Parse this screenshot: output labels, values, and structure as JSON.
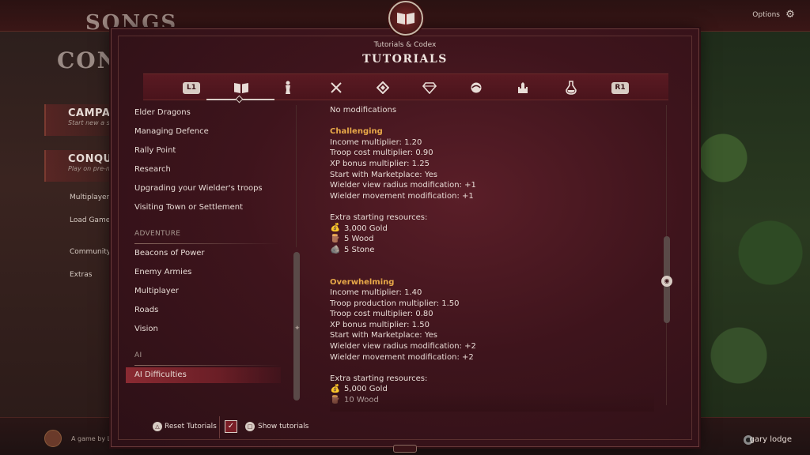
{
  "background": {
    "logo_line1": "SONGS",
    "logo_line2": "CONQ",
    "menu": {
      "campaign": {
        "label": "CAMPAIG",
        "sub": "Start new a st"
      },
      "conquest": {
        "label": "CONQUE",
        "sub": "Play on pre-m"
      },
      "multiplayer": "Multiplayer",
      "load_game": "Load Game",
      "community": "Community L",
      "extras": "Extras"
    },
    "options_label": "Options",
    "credit": "A game by La",
    "username": "gary lodge"
  },
  "header": {
    "subtitle": "Tutorials & Codex",
    "title": "TUTORIALS"
  },
  "tabs": [
    {
      "name": "L1",
      "icon": "l1-shoulder-button"
    },
    {
      "name": "Tutorials",
      "icon": "book-icon",
      "active": true
    },
    {
      "name": "Units",
      "icon": "figure-icon"
    },
    {
      "name": "Combat",
      "icon": "crossed-swords-icon"
    },
    {
      "name": "Rules",
      "icon": "diamond-icon"
    },
    {
      "name": "Resources",
      "icon": "gem-icon"
    },
    {
      "name": "Factions",
      "icon": "orb-icon"
    },
    {
      "name": "Buildings",
      "icon": "castle-icon"
    },
    {
      "name": "Items",
      "icon": "potion-icon"
    },
    {
      "name": "R1",
      "icon": "r1-shoulder-button"
    }
  ],
  "sidebar": {
    "items_top": [
      "Elder Dragons",
      "Managing Defence",
      "Rally Point",
      "Research",
      "Upgrading your Wielder's troops",
      "Visiting Town or Settlement"
    ],
    "section_adventure": "ADVENTURE",
    "items_adventure": [
      "Beacons of Power",
      "Enemy Armies",
      "Multiplayer",
      "Roads",
      "Vision"
    ],
    "section_ai": "AI",
    "items_ai": [
      "AI Difficulties"
    ]
  },
  "content": {
    "intro": "No modifications",
    "challenging": {
      "title": "Challenging",
      "lines": [
        "Income multiplier: 1.20",
        "Troop cost multiplier: 0.90",
        "XP bonus multiplier: 1.25",
        "Start with Marketplace: Yes",
        "Wielder view radius modification: +1",
        "Wielder movement modification: +1"
      ],
      "resources_label": "Extra starting resources:",
      "resources": [
        {
          "icon": "gold-icon",
          "glyph": "💰",
          "text": "3,000 Gold"
        },
        {
          "icon": "wood-icon",
          "glyph": "🪵",
          "text": "5 Wood"
        },
        {
          "icon": "stone-icon",
          "glyph": "🪨",
          "text": "5 Stone"
        }
      ]
    },
    "overwhelming": {
      "title": "Overwhelming",
      "lines": [
        "Income multiplier: 1.40",
        "Troop production multiplier: 1.50",
        "Troop cost multiplier: 0.80",
        "XP bonus multiplier: 1.50",
        "Start with Marketplace: Yes",
        "Wielder view radius modification: +2",
        "Wielder movement modification: +2"
      ],
      "resources_label": "Extra starting resources:",
      "resources": [
        {
          "icon": "gold-icon",
          "glyph": "💰",
          "text": "5,000 Gold"
        },
        {
          "icon": "wood-icon",
          "glyph": "🪵",
          "text": "10 Wood"
        }
      ]
    }
  },
  "footer": {
    "reset_label": "Reset Tutorials",
    "reset_button": "△",
    "show_tutorials_label": "Show tutorials",
    "show_tutorials_button": "□",
    "show_tutorials_checked": true,
    "checkmark": "✓"
  },
  "colors": {
    "accent_heading": "#e8a848",
    "active_item": "#8a2a32",
    "panel_bg": "#3e141c"
  }
}
